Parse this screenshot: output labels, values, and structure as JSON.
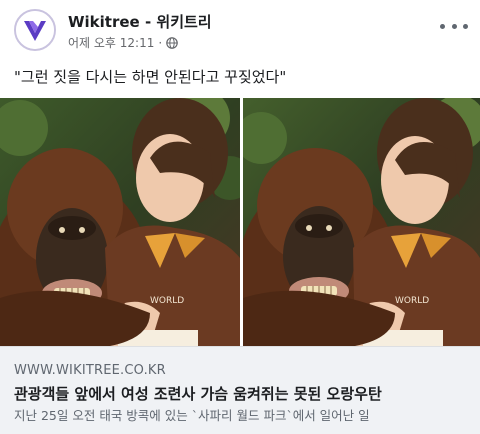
{
  "post": {
    "page_name": "Wikitree - 위키트리",
    "time": "어제 오후 12:11",
    "separator": "·",
    "privacy_icon": "globe-icon",
    "text": "\"그런 짓을 다시는 하면 안된다고 꾸짖었다\"",
    "more_icon": "more-options-icon"
  },
  "photos": {
    "left_alt": "orangutan-with-zookeeper-photo",
    "right_alt": "orangutan-with-zookeeper-photo",
    "shirt_logo": "WORLD"
  },
  "link": {
    "domain": "WWW.WIKITREE.CO.KR",
    "title": "관광객들 앞에서 여성 조련사 가슴 움켜쥐는 못된 오랑우탄",
    "description": "지난 25일 오전 태국 방콕에 있는 `사파리 월드 파크`에서 일어난 일"
  },
  "colors": {
    "brand_purple": "#5b3cc4",
    "card_bg": "#f0f2f5",
    "secondary_text": "#606770",
    "shirt_brown": "#6b3a22"
  }
}
